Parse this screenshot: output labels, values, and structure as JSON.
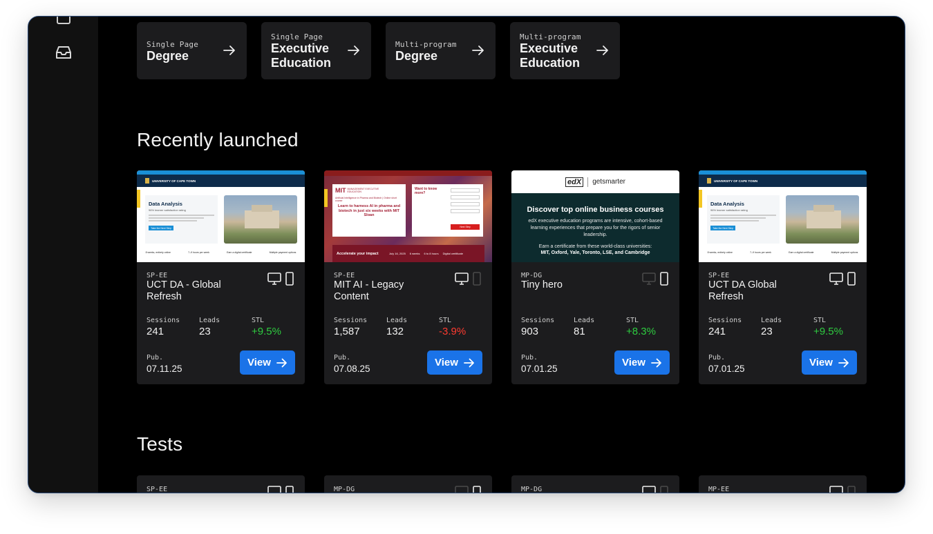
{
  "program_types": [
    {
      "kicker": "Single Page",
      "title": "Degree"
    },
    {
      "kicker": "Single Page",
      "title": "Executive Education"
    },
    {
      "kicker": "Multi-program",
      "title": "Degree"
    },
    {
      "kicker": "Multi-program",
      "title": "Executive Education"
    }
  ],
  "recently_launched": {
    "heading": "Recently launched",
    "cards": [
      {
        "code": "SP-EE",
        "name": "UCT DA - Global Refresh",
        "sessions_label": "Sessions",
        "sessions": "241",
        "leads_label": "Leads",
        "leads": "23",
        "stl_label": "STL",
        "stl": "+9.5%",
        "pub_label": "Pub.",
        "pub": "07.11.25",
        "view_label": "View",
        "thumb": {
          "university": "UNIVERSITY OF CAPE TOWN",
          "title": "Data Analysis",
          "rating": "96% learner satisfaction rating",
          "cta": "Take the Next Step",
          "features": [
            "8 weeks, entirely online",
            "7–9 hours per week",
            "Earn a digital certificate",
            "Multiple payment options"
          ]
        }
      },
      {
        "code": "SP-EE",
        "name": "MIT AI - Legacy Content",
        "sessions_label": "Sessions",
        "sessions": "1,587",
        "leads_label": "Leads",
        "leads": "132",
        "stl_label": "STL",
        "stl": "-3.9%",
        "pub_label": "Pub.",
        "pub": "07.08.25",
        "view_label": "View",
        "thumb": {
          "brand": "MIT",
          "brand_sub": "MANAGEMENT EXECUTIVE EDUCATION",
          "course": "Artificial Intelligence in Pharma and Biotech | Online short course",
          "headline": "Learn to harness AI in pharma and biotech in just six weeks with MIT Sloan",
          "form_title": "Want to know more?",
          "form_btn": "Next Step",
          "impact": "Accelerate your impact",
          "date": "July 16, 2025",
          "weeks": "6 weeks",
          "hours": "6 to 8 hours",
          "cert": "Digital certificate"
        }
      },
      {
        "code": "MP-DG",
        "name": "Tiny hero",
        "sessions_label": "Sessions",
        "sessions": "903",
        "leads_label": "Leads",
        "leads": "81",
        "stl_label": "STL",
        "stl": "+8.3%",
        "pub_label": "Pub.",
        "pub": "07.01.25",
        "view_label": "View",
        "thumb": {
          "logo_a": "edX",
          "logo_b": "getsmarter",
          "headline": "Discover top online business courses",
          "body": "edX executive education programs are intensive, cohort-based learning experiences that prepare you for the rigors of senior leadership.",
          "cert": "Earn a certificate from these world-class universities:",
          "unis": "MIT, Oxford, Yale, Toronto, LSE, and Cambridge"
        }
      },
      {
        "code": "SP-EE",
        "name": "UCT DA Global Refresh",
        "sessions_label": "Sessions",
        "sessions": "241",
        "leads_label": "Leads",
        "leads": "23",
        "stl_label": "STL",
        "stl": "+9.5%",
        "pub_label": "Pub.",
        "pub": "07.01.25",
        "view_label": "View",
        "thumb": {
          "university": "UNIVERSITY OF CAPE TOWN",
          "title": "Data Analysis",
          "rating": "96% learner satisfaction rating",
          "cta": "Take the Next Step",
          "features": [
            "8 weeks, entirely online",
            "7–9 hours per week",
            "Earn a digital certificate",
            "Multiple payment options"
          ]
        }
      }
    ]
  },
  "tests": {
    "heading": "Tests",
    "cards": [
      {
        "code": "SP-EE"
      },
      {
        "code": "MP-DG"
      },
      {
        "code": "MP-DG"
      },
      {
        "code": "MP-EE"
      }
    ]
  },
  "colors": {
    "accent": "#1a73e8",
    "positive": "#2ecc40",
    "negative": "#ff3b30",
    "card": "#1c1c1e",
    "sidebar": "#111111"
  },
  "icons": [
    "inbox-icon",
    "arrow-right-icon",
    "desktop-icon",
    "mobile-icon"
  ]
}
